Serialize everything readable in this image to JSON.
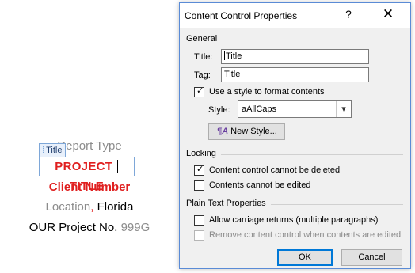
{
  "document": {
    "report_type": "Report Type",
    "content_control_tag": "Title",
    "project_title_a": "PROJECT ",
    "project_title_b": "TITLE",
    "client_number": "Client Number",
    "location_part": "Location",
    "location_comma": ",",
    "location_state": " Florida",
    "project_no_label": "OUR Project No. ",
    "project_no_value": "999G"
  },
  "dialog": {
    "title": "Content Control Properties",
    "help": "?",
    "close": "✕",
    "general": {
      "section_label": "General",
      "title_label": "Title:",
      "title_value": "Title",
      "tag_label": "Tag:",
      "tag_value": "Title",
      "use_style_label": "Use a style to format contents",
      "use_style_checked": true,
      "style_label": "Style:",
      "style_value": "aAllCaps",
      "new_style_button": "New Style..."
    },
    "locking": {
      "section_label": "Locking",
      "cannot_delete_label": "Content control cannot be deleted",
      "cannot_delete_checked": true,
      "cannot_edit_label": "Contents cannot be edited",
      "cannot_edit_checked": false
    },
    "plain_text": {
      "section_label": "Plain Text Properties",
      "carriage_returns_label": "Allow carriage returns (multiple paragraphs)",
      "carriage_returns_checked": false,
      "remove_when_edited_label": "Remove content control when contents are edited",
      "remove_when_edited_checked": false
    },
    "ok_button": "OK",
    "cancel_button": "Cancel"
  },
  "colors": {
    "accent_red": "#e02020",
    "dialog_border": "#5a8bd6",
    "primary_button_border": "#0078d7"
  }
}
